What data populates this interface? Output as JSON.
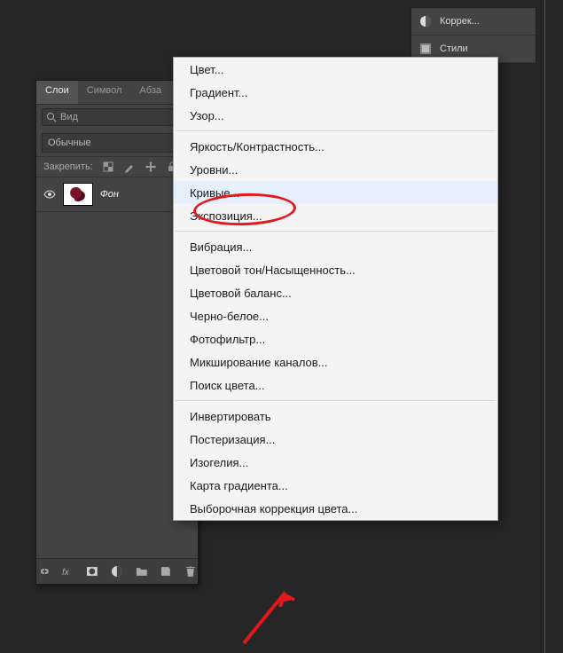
{
  "sidepanel": {
    "items": [
      {
        "label": "Коррек...",
        "icon": "circle-half"
      },
      {
        "label": "Стили",
        "icon": "styles"
      }
    ]
  },
  "layers": {
    "tabs": [
      {
        "label": "Слои",
        "active": true
      },
      {
        "label": "Символ",
        "active": false
      },
      {
        "label": "Абза",
        "active": false
      }
    ],
    "search": {
      "placeholder": "Вид"
    },
    "blendmode": "Обычные",
    "lockLabel": "Закрепить:",
    "layer": {
      "name": "Фон"
    }
  },
  "menu": {
    "items": [
      {
        "label": "Цвет..."
      },
      {
        "label": "Градиент..."
      },
      {
        "label": "Узор..."
      },
      {
        "sep": true
      },
      {
        "label": "Яркость/Контрастность..."
      },
      {
        "label": "Уровни..."
      },
      {
        "label": "Кривые...",
        "highlight": true
      },
      {
        "label": "Экспозиция..."
      },
      {
        "sep": true
      },
      {
        "label": "Вибрация..."
      },
      {
        "label": "Цветовой тон/Насыщенность..."
      },
      {
        "label": "Цветовой баланс..."
      },
      {
        "label": "Черно-белое..."
      },
      {
        "label": "Фотофильтр..."
      },
      {
        "label": "Микширование каналов..."
      },
      {
        "label": "Поиск цвета..."
      },
      {
        "sep": true
      },
      {
        "label": "Инвертировать"
      },
      {
        "label": "Постеризация..."
      },
      {
        "label": "Изогелия..."
      },
      {
        "label": "Карта градиента..."
      },
      {
        "label": "Выборочная коррекция цвета..."
      }
    ]
  }
}
